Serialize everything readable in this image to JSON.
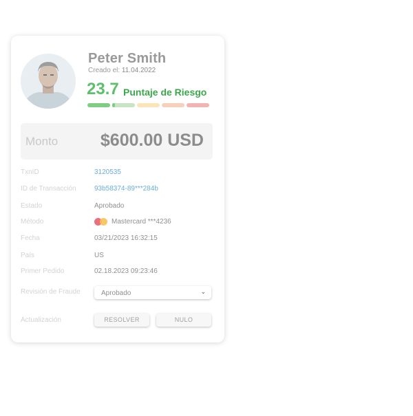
{
  "user": {
    "name": "Peter Smith",
    "created_label": "Creado el:",
    "created_date": "11.04.2022",
    "avatar_icon": "user-avatar-icon"
  },
  "risk": {
    "score": "23.7",
    "label": "Puntaje de Riesgo",
    "level_fraction": 0.237,
    "segment_colors": [
      "#7fcc83",
      "#c7e4c3",
      "#fbe5b8",
      "#f7d0bc",
      "#f2b3b3"
    ]
  },
  "amount": {
    "label": "Monto",
    "value": "$600.00 USD"
  },
  "details": [
    {
      "key": "TxnID",
      "value": "3120535",
      "link": true
    },
    {
      "key": "ID de Transacción",
      "value": "93b58374-89***284b",
      "link": true
    },
    {
      "key": "Estado",
      "value": "Aprobado",
      "link": false
    },
    {
      "key": "Método",
      "value": "Mastercard ***4236",
      "link": false,
      "icon": "mastercard-icon"
    },
    {
      "key": "Fecha",
      "value": "03/21/2023 16:32:15",
      "link": false
    },
    {
      "key": "País",
      "value": "US",
      "link": false
    },
    {
      "key": "Primer Pedido",
      "value": "02.18.2023 09:23:46",
      "link": false
    }
  ],
  "fraud_review": {
    "label": "Revisión de Fraude",
    "selected": "Aprobado"
  },
  "update": {
    "label": "Actualización",
    "resolve_label": "RESOLVER",
    "void_label": "NULO"
  }
}
